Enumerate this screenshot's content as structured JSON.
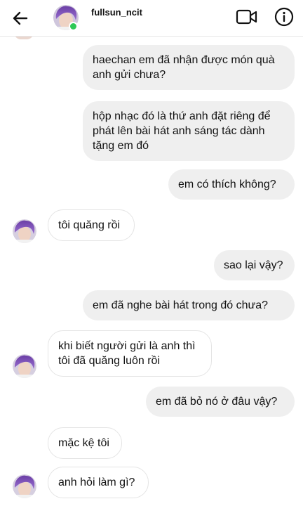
{
  "header": {
    "username": "fullsun_ncit",
    "back_icon": "arrow-left-icon",
    "video_icon": "video-camera-icon",
    "info_icon": "info-icon",
    "status_color": "#2ec956"
  },
  "messages": [
    {
      "from": "me",
      "text": "haechan em đã nhận được món quà anh gửi chưa?"
    },
    {
      "from": "me",
      "text": "hộp nhạc đó là thứ anh đặt riêng để phát lên bài hát anh sáng tác dành tặng em đó"
    },
    {
      "from": "me",
      "text": "em có thích không?"
    },
    {
      "from": "them",
      "text": "tôi quăng rồi"
    },
    {
      "from": "me",
      "text": "sao lại vậy?"
    },
    {
      "from": "me",
      "text": "em đã nghe bài hát trong đó chưa?"
    },
    {
      "from": "them",
      "text": "khi biết người gửi là anh thì tôi đã quăng luôn rồi"
    },
    {
      "from": "me",
      "text": "em đã bỏ nó ở đâu vậy?"
    },
    {
      "from": "them",
      "text": "mặc kệ tôi"
    },
    {
      "from": "them",
      "text": "anh hỏi làm gì?"
    }
  ],
  "colors": {
    "outgoing_bubble": "#efefef",
    "incoming_bubble_border": "#e4e4e4"
  }
}
